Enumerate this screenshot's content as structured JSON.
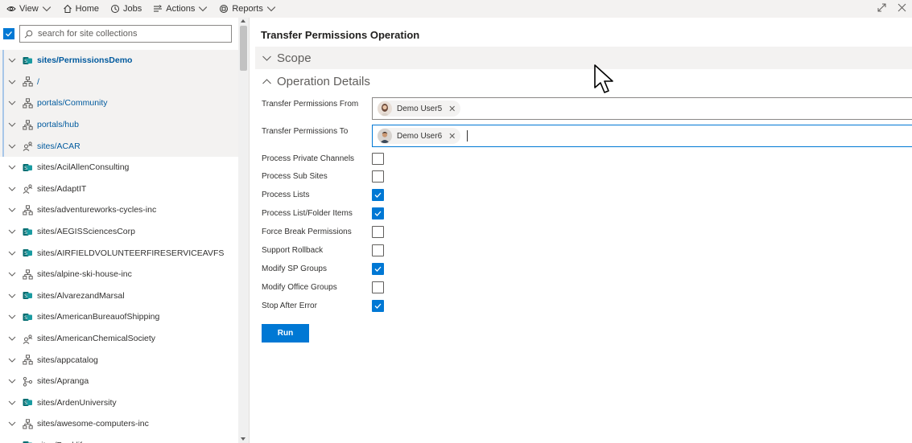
{
  "toolbar": {
    "view": "View",
    "home": "Home",
    "jobs": "Jobs",
    "actions": "Actions",
    "reports": "Reports"
  },
  "search": {
    "placeholder": "search for site collections"
  },
  "sites": [
    {
      "label": "sites/PermissionsDemo",
      "icon": "sharepoint-site-icon",
      "selected": true,
      "bold": true
    },
    {
      "label": "/",
      "icon": "site-hierarchy-icon",
      "selected": true
    },
    {
      "label": "portals/Community",
      "icon": "site-hierarchy-icon",
      "selected": true
    },
    {
      "label": "portals/hub",
      "icon": "site-hierarchy-icon",
      "selected": true
    },
    {
      "label": "sites/ACAR",
      "icon": "people-site-icon",
      "selected": true
    },
    {
      "label": "sites/AcilAllenConsulting",
      "icon": "sharepoint-site-icon"
    },
    {
      "label": "sites/AdaptIT",
      "icon": "people-site-icon"
    },
    {
      "label": "sites/adventureworks-cycles-inc",
      "icon": "site-hierarchy-icon"
    },
    {
      "label": "sites/AEGISSciencesCorp",
      "icon": "sharepoint-site-icon"
    },
    {
      "label": "sites/AIRFIELDVOLUNTEERFIRESERVICEAVFS",
      "icon": "sharepoint-site-icon"
    },
    {
      "label": "sites/alpine-ski-house-inc",
      "icon": "site-hierarchy-icon"
    },
    {
      "label": "sites/AlvarezandMarsal",
      "icon": "sharepoint-site-icon"
    },
    {
      "label": "sites/AmericanBureauofShipping",
      "icon": "sharepoint-site-icon"
    },
    {
      "label": "sites/AmericanChemicalSociety",
      "icon": "people-site-icon"
    },
    {
      "label": "sites/appcatalog",
      "icon": "site-hierarchy-icon"
    },
    {
      "label": "sites/Apranga",
      "icon": "branch-site-icon"
    },
    {
      "label": "sites/ArdenUniversity",
      "icon": "sharepoint-site-icon"
    },
    {
      "label": "sites/awesome-computers-inc",
      "icon": "site-hierarchy-icon"
    },
    {
      "label": "sites/Banklife",
      "icon": "sharepoint-site-icon"
    }
  ],
  "main": {
    "title": "Transfer Permissions Operation",
    "scope_label": "Scope",
    "details_label": "Operation Details",
    "from_label": "Transfer Permissions From",
    "to_label": "Transfer Permissions To",
    "from_user": "Demo User5",
    "to_user": "Demo User6",
    "options": [
      {
        "label": "Process Private Channels",
        "checked": false
      },
      {
        "label": "Process Sub Sites",
        "checked": false
      },
      {
        "label": "Process Lists",
        "checked": true
      },
      {
        "label": "Process List/Folder Items",
        "checked": true
      },
      {
        "label": "Force Break Permissions",
        "checked": false
      },
      {
        "label": "Support Rollback",
        "checked": false
      },
      {
        "label": "Modify SP Groups",
        "checked": true
      },
      {
        "label": "Modify Office Groups",
        "checked": false
      },
      {
        "label": "Stop After Error",
        "checked": true
      }
    ],
    "run_label": "Run"
  },
  "colors": {
    "accent": "#0078d4",
    "selected_bg": "#f3f2f1"
  }
}
